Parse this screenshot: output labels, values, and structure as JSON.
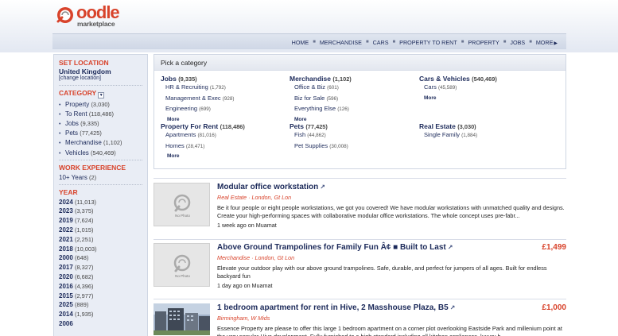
{
  "brand": {
    "name": "oodle",
    "sub": "marketplace"
  },
  "nav": {
    "items": [
      "HOME",
      "MERCHANDISE",
      "CARS",
      "PROPERTY TO RENT",
      "PROPERTY",
      "JOBS",
      "MORE"
    ]
  },
  "sidebar": {
    "set_location_label": "SET LOCATION",
    "location": "United Kingdom",
    "change_location": "[change location]",
    "category_label": "CATEGORY",
    "categories": [
      {
        "label": "Property",
        "count": "(3,030)"
      },
      {
        "label": "To Rent",
        "count": "(118,486)"
      },
      {
        "label": "Jobs",
        "count": "(9,335)"
      },
      {
        "label": "Pets",
        "count": "(77,425)"
      },
      {
        "label": "Merchandise",
        "count": "(1,102)"
      },
      {
        "label": "Vehicles",
        "count": "(540,469)"
      }
    ],
    "work_exp_label": "WORK EXPERIENCE",
    "work_exp": "10+ Years",
    "work_exp_count": "(2)",
    "year_label": "YEAR",
    "years": [
      {
        "year": "2024",
        "count": "(11,013)"
      },
      {
        "year": "2023",
        "count": "(3,375)"
      },
      {
        "year": "2019",
        "count": "(7,624)"
      },
      {
        "year": "2022",
        "count": "(1,015)"
      },
      {
        "year": "2021",
        "count": "(2,251)"
      },
      {
        "year": "2018",
        "count": "(10,003)"
      },
      {
        "year": "2000",
        "count": "(648)"
      },
      {
        "year": "2017",
        "count": "(8,327)"
      },
      {
        "year": "2020",
        "count": "(6,682)"
      },
      {
        "year": "2016",
        "count": "(4,396)"
      },
      {
        "year": "2015",
        "count": "(2,977)"
      },
      {
        "year": "2025",
        "count": "(889)"
      },
      {
        "year": "2014",
        "count": "(1,935)"
      },
      {
        "year": "2006",
        "count": ""
      }
    ]
  },
  "catbox": {
    "title": "Pick a category",
    "more": "More",
    "jobs": {
      "label": "Jobs",
      "count": "(9,335)",
      "subs": [
        {
          "label": "HR & Recruiting",
          "count": "(1,792)"
        },
        {
          "label": "Management & Exec",
          "count": "(928)"
        },
        {
          "label": "Engineering",
          "count": "(699)"
        }
      ]
    },
    "merch": {
      "label": "Merchandise",
      "count": "(1,102)",
      "subs": [
        {
          "label": "Office & Biz",
          "count": "(601)"
        },
        {
          "label": "Biz for Sale",
          "count": "(596)"
        },
        {
          "label": "Everything Else",
          "count": "(126)"
        }
      ]
    },
    "cars": {
      "label": "Cars & Vehicles",
      "count": "(540,469)",
      "subs": [
        {
          "label": "Cars",
          "count": "(45,589)"
        }
      ]
    },
    "rent": {
      "label": "Property For Rent",
      "count": "(118,486)",
      "subs": [
        {
          "label": "Apartments",
          "count": "(81,016)"
        },
        {
          "label": "Homes",
          "count": "(28,471)"
        }
      ]
    },
    "pets": {
      "label": "Pets",
      "count": "(77,425)",
      "subs": [
        {
          "label": "Fish",
          "count": "(44,862)"
        },
        {
          "label": "Pet Supplies",
          "count": "(30,008)"
        }
      ]
    },
    "realestate": {
      "label": "Real Estate",
      "count": "(3,030)",
      "subs": [
        {
          "label": "Single Family",
          "count": "(1,884)"
        }
      ]
    }
  },
  "listings": [
    {
      "title": "Modular office workstation",
      "price": "",
      "category": "Real Estate · London, Gt Lon",
      "desc": "Be it four people or eight people workstations, we got you covered! We have modular workstations with unmatched quality and designs. Create your high-performing spaces with collaborative modular office workstations. The whole concept uses pre-fabr...",
      "meta": "1 week ago on Muamat",
      "thumb_text": "No Photo"
    },
    {
      "title": "Above Ground Trampolines for Family Fun Â¢ ■ Built to Last",
      "price": "£1,499",
      "category": "Merchandise · London, Gt Lon",
      "desc": "Elevate your outdoor play with our above ground trampolines. Safe, durable, and perfect for jumpers of all ages. Built for endless backyard fun",
      "meta": "1 day ago on Muamat",
      "thumb_text": "No Photo"
    },
    {
      "title": "1 bedroom apartment for rent in Hive, 2 Masshouse Plaza, B5",
      "price": "£1,000",
      "category": "Birmingham, W Mids",
      "desc": "Essence Property are please to offer this large 1 bedroom apartment on a corner plot overlooking Eastside Park and millenium point at the very popular Hive development. Fully furnished to a high standard including all kitchen appliances, luxury h...",
      "meta": "",
      "thumb_text": ""
    }
  ]
}
